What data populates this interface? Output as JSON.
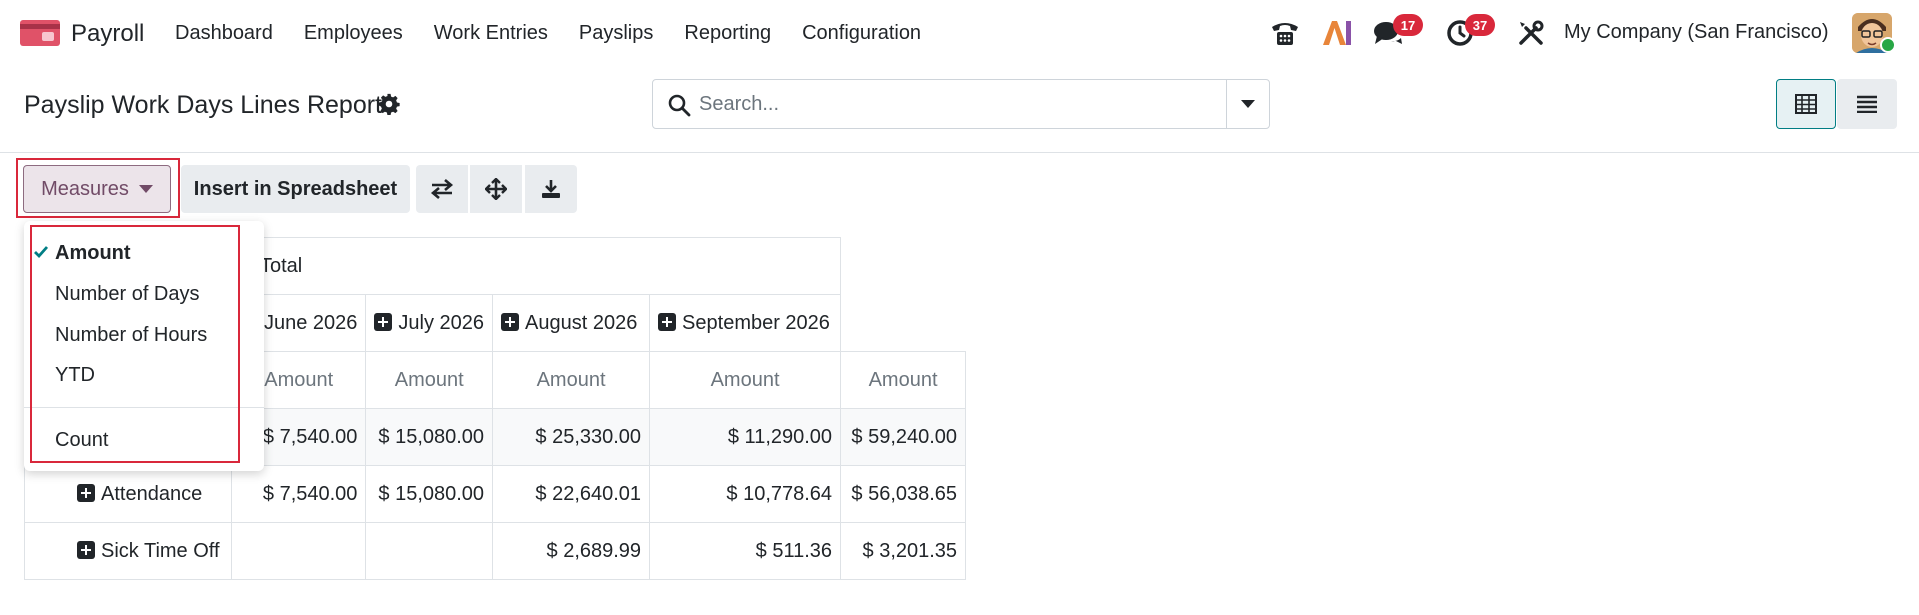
{
  "navbar": {
    "app_name": "Payroll",
    "menu": [
      "Dashboard",
      "Employees",
      "Work Entries",
      "Payslips",
      "Reporting",
      "Configuration"
    ],
    "messages_badge": "17",
    "activities_badge": "37",
    "company": "My Company (San Francisco)",
    "icons": [
      "phone-icon",
      "ai-icon",
      "chat-icon",
      "clock-icon",
      "tools-icon"
    ]
  },
  "control_panel": {
    "title": "Payslip Work Days Lines Report",
    "search_placeholder": "Search..."
  },
  "toolbar": {
    "measures_label": "Measures",
    "spreadsheet_label": "Insert in Spreadsheet"
  },
  "measures_menu": {
    "items": [
      "Amount",
      "Number of Days",
      "Number of Hours",
      "YTD"
    ],
    "selected": "Amount",
    "count_label": "Count"
  },
  "pivot": {
    "total_header": "Total",
    "months": [
      "June 2026",
      "July 2026",
      "August 2026",
      "September 2026"
    ],
    "measure": "Amount",
    "total_row": [
      "$ 7,540.00",
      "$ 15,080.00",
      "$ 25,330.00",
      "$ 11,290.00",
      "$ 59,240.00"
    ],
    "rows": [
      {
        "label": "Attendance",
        "values": [
          "$ 7,540.00",
          "$ 15,080.00",
          "$ 22,640.01",
          "$ 10,778.64",
          "$ 56,038.65"
        ]
      },
      {
        "label": "Sick Time Off",
        "values": [
          "",
          "",
          "$ 2,689.99",
          "$ 511.36",
          "$ 3,201.35"
        ]
      }
    ]
  },
  "colors": {
    "brand": "#714b67",
    "accent": "#017e84",
    "badge": "#d9283b",
    "highlight": "#d9283b"
  }
}
